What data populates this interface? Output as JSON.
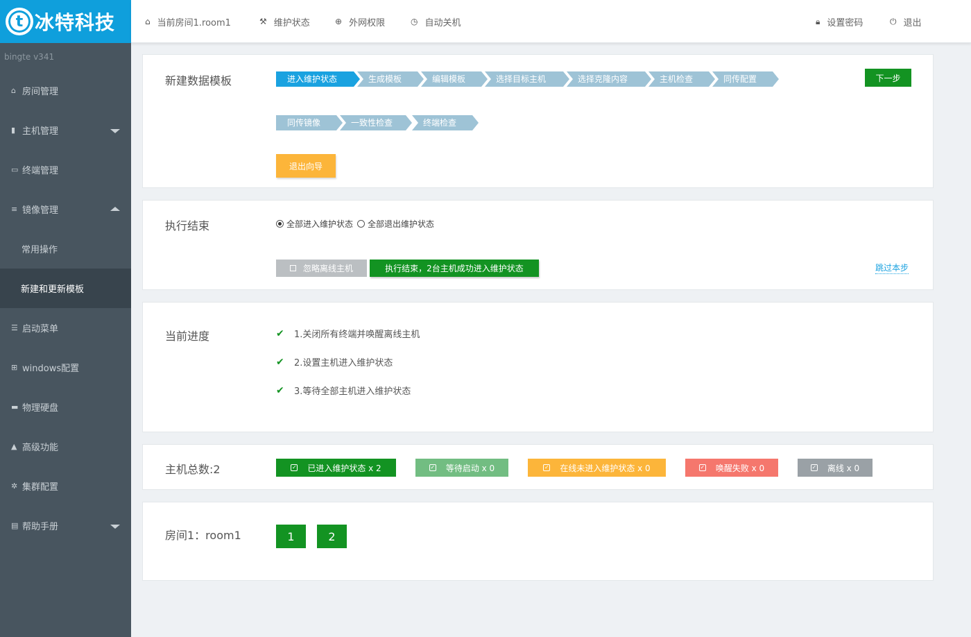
{
  "sidebar": {
    "logo_badge": "t",
    "logo_text": "冰特科技",
    "version": "bingte  v341",
    "items": [
      {
        "icon": "home-icon",
        "glyph": "⌂",
        "label": "房间管理"
      },
      {
        "icon": "server-icon",
        "glyph": "▮",
        "label": "主机管理"
      },
      {
        "icon": "monitor-icon",
        "glyph": "▭",
        "label": "终端管理"
      },
      {
        "icon": "database-icon",
        "glyph": "≡",
        "label": "镜像管理"
      },
      {
        "label": "常用操作"
      },
      {
        "label": "新建和更新模板"
      },
      {
        "icon": "list-icon",
        "glyph": "☰",
        "label": "启动菜单"
      },
      {
        "icon": "windows-icon",
        "glyph": "⊞",
        "label": "windows配置"
      },
      {
        "icon": "harddisk-icon",
        "glyph": "▬",
        "label": "物理硬盘"
      },
      {
        "icon": "warning-icon",
        "glyph": "▲",
        "label": "高级功能"
      },
      {
        "icon": "cog-icon",
        "glyph": "✲",
        "label": "集群配置"
      },
      {
        "icon": "book-icon",
        "glyph": "▤",
        "label": "帮助手册"
      }
    ]
  },
  "topbar": {
    "room": "当前房间1.room1",
    "maintenance": "维护状态",
    "internet": "外网权限",
    "shutdown": "自动关机",
    "password": "设置密码",
    "logout": "退出"
  },
  "wizard": {
    "title": "新建数据模板",
    "steps": [
      "进入维护状态",
      "生成模板",
      "编辑模板",
      "选择目标主机",
      "选择克隆内容",
      "主机检查",
      "同传配置",
      "同传镜像",
      "一致性检查",
      "终端检查"
    ],
    "active_step": 0,
    "next_label": "下一步",
    "exit_label": "退出向导"
  },
  "exec": {
    "title": "执行结束",
    "radio_enter": "全部进入维护状态",
    "radio_exit": "全部退出维护状态",
    "ignore_label": "忽略离线主机",
    "result_label": "执行结束，2台主机成功进入维护状态",
    "skip_label": "跳过本步"
  },
  "progress": {
    "title": "当前进度",
    "items": [
      "1.关闭所有终端并唤醒离线主机",
      "2.设置主机进入维护状态",
      "3.等待全部主机进入维护状态"
    ]
  },
  "hosts": {
    "title": "主机总数:2",
    "stats": [
      {
        "label": "已进入维护状态 x 2",
        "color": "#139322"
      },
      {
        "label": "等待启动 x 0",
        "color": "#72bd82"
      },
      {
        "label": "在线未进入维护状态 x 0",
        "color": "#fcb53a"
      },
      {
        "label": "唤醒失败 x 0",
        "color": "#f5776d"
      },
      {
        "label": "离线 x 0",
        "color": "#9aa1a6"
      }
    ]
  },
  "room": {
    "title": "房间1：room1",
    "hosts": [
      "1",
      "2"
    ]
  }
}
